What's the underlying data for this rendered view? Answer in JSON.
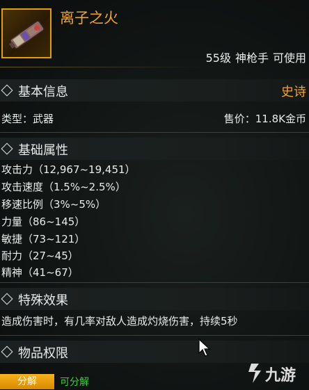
{
  "item": {
    "name": "离子之火",
    "icon": "weapon-icon",
    "level_req": "55级",
    "class_req": "神枪手",
    "usable": "可使用"
  },
  "basic_info": {
    "header": "基本信息",
    "rarity": "史诗",
    "type_text": "类型：武器",
    "price_text": "售价：11.8K金币"
  },
  "base_attributes": {
    "header": "基础属性",
    "items": [
      "攻击力（12,967~19,451）",
      "攻击速度（1.5%~2.5%）",
      "移速比例（3%~5%）",
      "力量（86~145）",
      "敏捷（73~121）",
      "耐力（27~45）",
      "精神（41~67）"
    ]
  },
  "special_effect": {
    "header": "特殊效果",
    "text": "造成伤害时，有几率对敌人造成灼烧伤害，持续5秒"
  },
  "permissions": {
    "header": "物品权限",
    "decompose_label": "分解",
    "decompose_status": "可分解"
  },
  "watermark": {
    "text": "九游"
  },
  "colors": {
    "accent": "#f0a42a",
    "rarity_epic": "#f0a42a",
    "status_green": "#3ecf3e",
    "button_gold": "#f7b21c",
    "text": "#e8ecea"
  }
}
